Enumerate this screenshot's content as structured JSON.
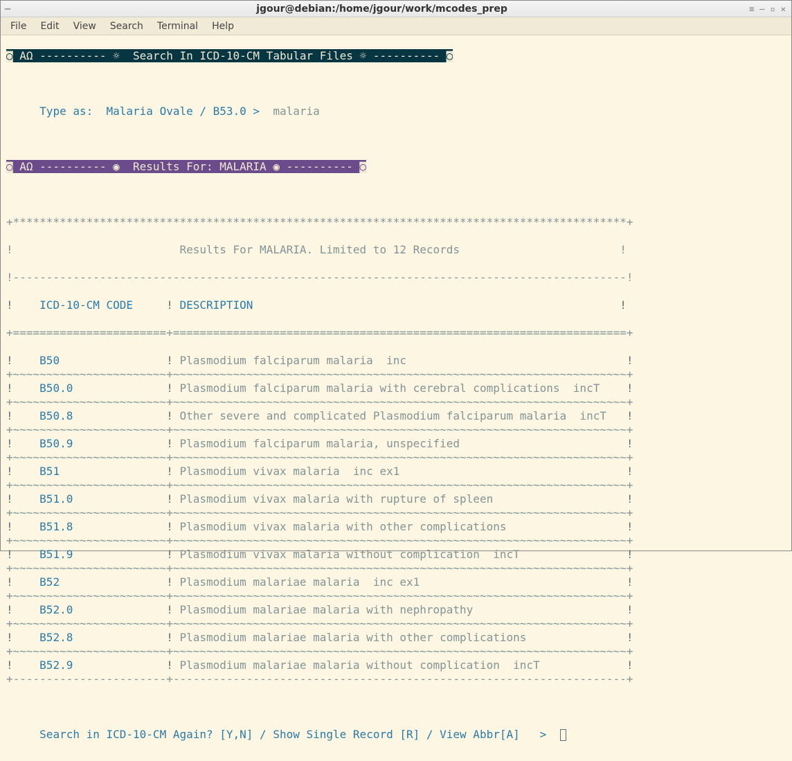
{
  "window": {
    "title": "jgour@debian:/home/jgour/work/mcodes_prep"
  },
  "menu": {
    "file": "File",
    "edit": "Edit",
    "view": "View",
    "search": "Search",
    "terminal": "Terminal",
    "help": "Help"
  },
  "headerBar": {
    "text": "◙ ΑΩ ---------- ☼  Search In ICD-10-CM Tabular Files ☼ ---------- ◙"
  },
  "prompt": {
    "label": "Type as:  Malaria Ovale / B53.0 >",
    "value": "malaria"
  },
  "resultsBar": {
    "text": "◙ ΑΩ ---------- ◉  Results For: MALARIA ◉ ---------- ◙"
  },
  "tableTitle": "Results For MALARIA. Limited to 12 Records",
  "columns": {
    "code": "ICD-10-CM CODE",
    "desc": "DESCRIPTION"
  },
  "rows": [
    {
      "code": "B50",
      "desc": "Plasmodium falciparum malaria  inc"
    },
    {
      "code": "B50.0",
      "desc": "Plasmodium falciparum malaria with cerebral complications  incT"
    },
    {
      "code": "B50.8",
      "desc": "Other severe and complicated Plasmodium falciparum malaria  incT"
    },
    {
      "code": "B50.9",
      "desc": "Plasmodium falciparum malaria, unspecified"
    },
    {
      "code": "B51",
      "desc": "Plasmodium vivax malaria  inc ex1"
    },
    {
      "code": "B51.0",
      "desc": "Plasmodium vivax malaria with rupture of spleen"
    },
    {
      "code": "B51.8",
      "desc": "Plasmodium vivax malaria with other complications"
    },
    {
      "code": "B51.9",
      "desc": "Plasmodium vivax malaria without complication  incT"
    },
    {
      "code": "B52",
      "desc": "Plasmodium malariae malaria  inc ex1"
    },
    {
      "code": "B52.0",
      "desc": "Plasmodium malariae malaria with nephropathy"
    },
    {
      "code": "B52.8",
      "desc": "Plasmodium malariae malaria with other complications"
    },
    {
      "code": "B52.9",
      "desc": "Plasmodium malariae malaria without complication  incT"
    }
  ],
  "footerPrompt": "Search in ICD-10-CM Again? [Y,N] / Show Single Record [R] / View Abbr[A]   >"
}
